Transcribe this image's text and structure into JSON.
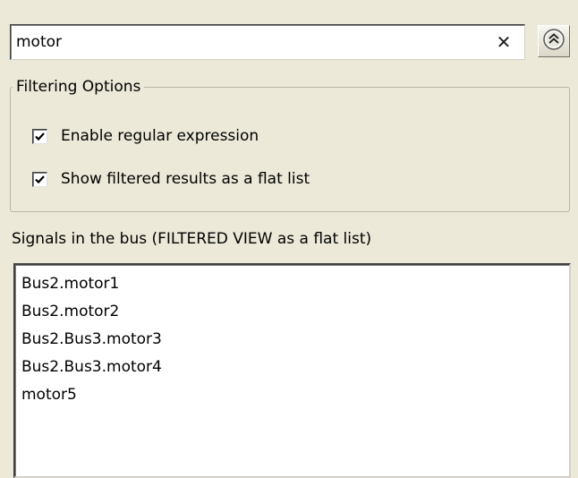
{
  "search": {
    "value": "motor",
    "clear_glyph": "✕",
    "clear_icon": "close-icon",
    "collapse_icon": "double-chevron-up-icon"
  },
  "filtering": {
    "legend": "Filtering Options",
    "options": [
      {
        "label": "Enable regular expression",
        "checked": true
      },
      {
        "label": "Show filtered results as a flat list",
        "checked": true
      }
    ]
  },
  "signals": {
    "heading": "Signals in the bus (FILTERED VIEW as a flat list)",
    "items": [
      "Bus2.motor1",
      "Bus2.motor2",
      "Bus2.Bus3.motor3",
      "Bus2.Bus3.motor4",
      "motor5"
    ]
  },
  "colors": {
    "panel_background": "#ece9d8",
    "list_background": "#ffffff",
    "checkmark": "#000000"
  }
}
